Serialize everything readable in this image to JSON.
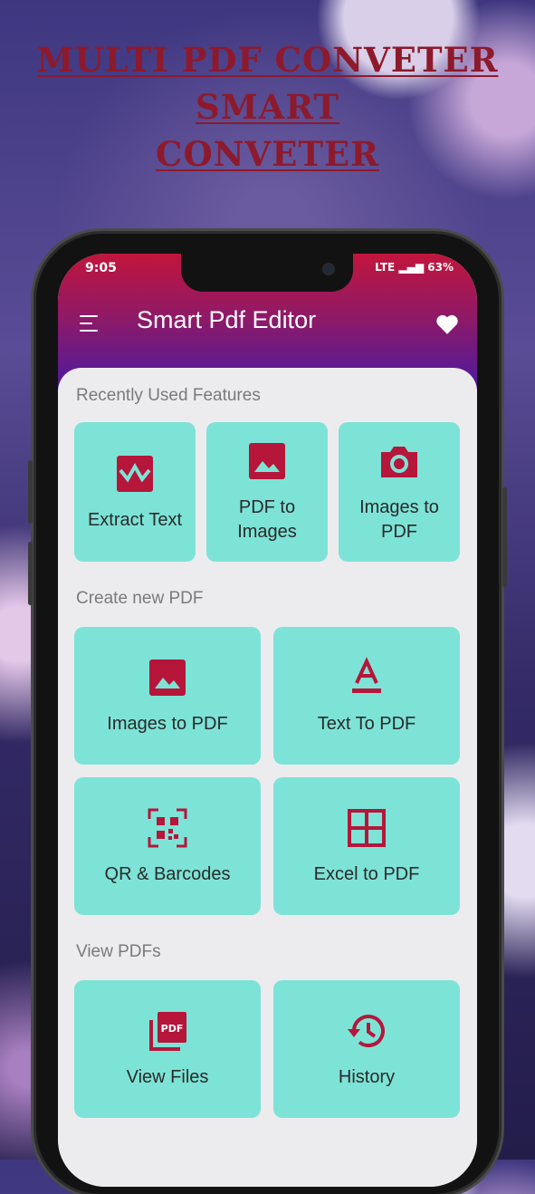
{
  "headline": {
    "line1": "MULTI PDF CONVETER",
    "line2": "SMART",
    "line3": "CONVETER"
  },
  "status_bar": {
    "time": "9:05",
    "battery": "63%",
    "network": "LTE"
  },
  "app_bar": {
    "title": "Smart Pdf Editor"
  },
  "sections": {
    "recent": "Recently Used Features",
    "create": "Create new PDF",
    "view": "View PDFs"
  },
  "recent_cards": [
    {
      "label": "Extract Text",
      "icon": "extract-text-icon"
    },
    {
      "label": "PDF to Images",
      "icon": "image-icon"
    },
    {
      "label": "Images to PDF",
      "icon": "camera-icon"
    }
  ],
  "create_cards": [
    {
      "label": "Images to PDF",
      "icon": "image-icon"
    },
    {
      "label": "Text To PDF",
      "icon": "text-icon"
    },
    {
      "label": "QR & Barcodes",
      "icon": "qr-code-icon"
    },
    {
      "label": "Excel to PDF",
      "icon": "grid-icon"
    }
  ],
  "view_cards": [
    {
      "label": "View Files",
      "icon": "pdf-file-icon"
    },
    {
      "label": "History",
      "icon": "history-icon"
    }
  ],
  "colors": {
    "accent": "#b5163a",
    "card": "#7de3d7",
    "headline": "#8d1a2c"
  }
}
